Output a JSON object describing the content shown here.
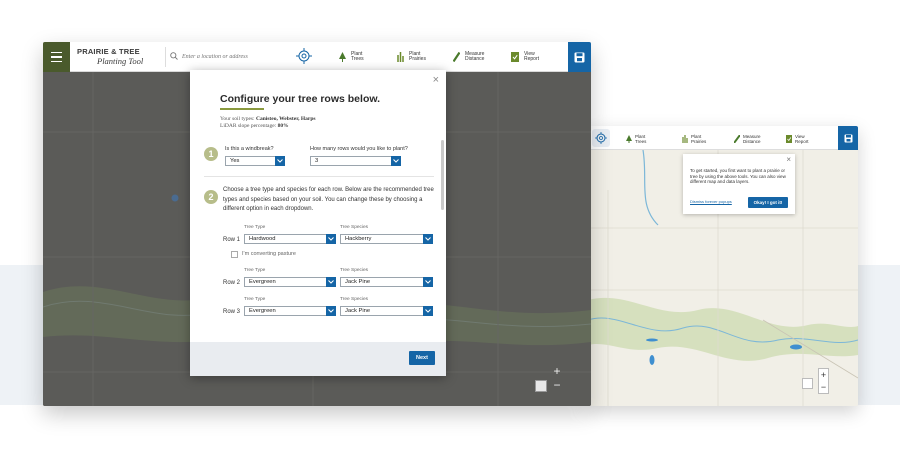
{
  "app": {
    "brand_line1": "PRAIRIE & TREE",
    "brand_line2": "Planting Tool"
  },
  "search": {
    "placeholder": "Enter a location or address"
  },
  "toolbar": [
    {
      "label1": "Plant",
      "label2": "Trees",
      "icon": "tree-icon"
    },
    {
      "label1": "Plant",
      "label2": "Prairies",
      "icon": "prairie-icon"
    },
    {
      "label1": "Measure",
      "label2": "Distance",
      "icon": "ruler-icon"
    },
    {
      "label1": "View",
      "label2": "Report",
      "icon": "report-icon"
    }
  ],
  "modal": {
    "title": "Configure your tree rows below.",
    "soil_label": "Your soil types:",
    "soil_value": "Canisteo, Webster, Harps",
    "slope_label": "LiDAR slope percentage:",
    "slope_value": "80%",
    "step1": {
      "number": "1",
      "windbreak_label": "Is this a windbreak?",
      "windbreak_value": "Yes",
      "rows_label": "How many rows would you like to plant?",
      "rows_value": "3"
    },
    "step2": {
      "number": "2",
      "text": "Choose a tree type and species for each row. Below are the recommended tree types and species based on your soil. You can change these by choosing a different option in each dropdown."
    },
    "col_type": "Tree Type",
    "col_species": "Tree Species",
    "pasture_label": "I'm converting pasture",
    "rows": [
      {
        "label": "Row 1",
        "type": "Hardwood",
        "species": "Hackberry"
      },
      {
        "label": "Row 2",
        "type": "Evergreen",
        "species": "Jack Pine"
      },
      {
        "label": "Row 3",
        "type": "Evergreen",
        "species": "Jack Pine"
      }
    ],
    "next_label": "Next"
  },
  "popup": {
    "text": "To get started, you first want to plant a prairie or tree by using the above tools. You can also view different map and data layers.",
    "dismiss_link": "Dismiss forever popups",
    "ok_label": "Okay! I got it!"
  },
  "map_controls": {
    "zoom_in": "+",
    "zoom_out": "−"
  },
  "colors": {
    "accent_blue": "#1565a6",
    "menu_green": "#4a5a2c",
    "step_badge": "#b7bd8a"
  }
}
